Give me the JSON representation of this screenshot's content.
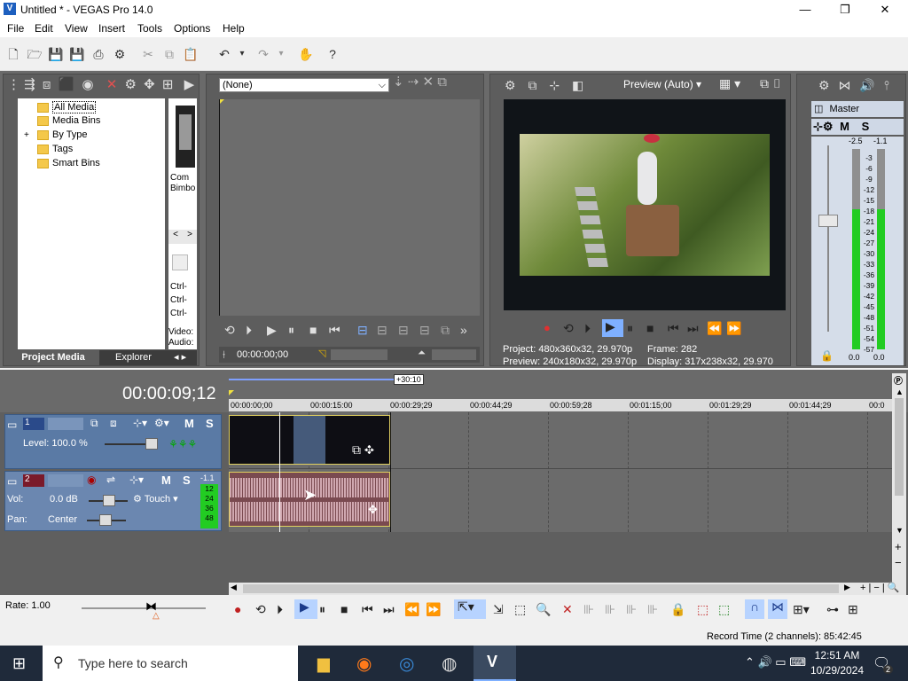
{
  "window": {
    "title": "Untitled * - VEGAS Pro 14.0",
    "minimize": "—",
    "maximize": "❐",
    "close": "✕"
  },
  "menu": [
    "File",
    "Edit",
    "View",
    "Insert",
    "Tools",
    "Options",
    "Help"
  ],
  "project_media": {
    "tree": [
      "All Media",
      "Media Bins",
      "By Type",
      "Tags",
      "Smart Bins"
    ],
    "expand": "+",
    "tabs": [
      "Project Media",
      "Explorer"
    ],
    "thumb_caption": [
      "Com",
      "Bimbo"
    ],
    "nav": [
      "<",
      ">"
    ],
    "ctrl_labels": [
      "Ctrl-",
      "Ctrl-",
      "Ctrl-"
    ],
    "bottom_labels": [
      "Video:",
      "Audio:"
    ]
  },
  "trimmer": {
    "dropdown": "(None)",
    "timecode": "00:00:00;00"
  },
  "preview": {
    "mode": "Preview (Auto)",
    "project_label": "Project:",
    "project_value": "480x360x32, 29.970p",
    "preview_label": "Preview:",
    "preview_value": "240x180x32, 29.970p",
    "frame_label": "Frame:",
    "frame_value": "282",
    "display_label": "Display:",
    "display_value": "317x238x32, 29.970"
  },
  "master": {
    "title": "Master",
    "peak_l": "-2.5",
    "peak_r": "-1.1",
    "scale": [
      "3",
      "6",
      "9",
      "12",
      "15",
      "18",
      "21",
      "24",
      "27",
      "30",
      "33",
      "36",
      "39",
      "42",
      "45",
      "48",
      "51",
      "54",
      "57"
    ],
    "level_l": "0.0",
    "level_r": "0.0",
    "ms": [
      "M",
      "S"
    ],
    "meter_fill": 0.7
  },
  "timeline": {
    "timecode": "00:00:09;12",
    "region_len": "+30:10",
    "ruler": [
      "00:00:00;00",
      "00:00:15:00",
      "00:00:29;29",
      "00:00:44;29",
      "00:00:59;28",
      "00:01:15;00",
      "00:01:29;29",
      "00:01:44;29",
      "00:0"
    ],
    "video_track": {
      "number": "1",
      "level_label": "Level: 100.0 %",
      "m": "M",
      "s": "S"
    },
    "audio_track": {
      "number": "2",
      "vol_label": "Vol:",
      "vol_value": "0.0 dB",
      "pan_label": "Pan:",
      "pan_value": "Center",
      "touch": "Touch",
      "m": "M",
      "s": "S",
      "peak": "-1.1",
      "meter_scale": [
        "12",
        "24",
        "36",
        "48"
      ]
    },
    "rate": "Rate: 1.00",
    "record_time": "Record Time (2 channels): 85:42:45"
  },
  "taskbar": {
    "search_placeholder": "Type here to search",
    "time": "12:51 AM",
    "date": "10/29/2024",
    "notifications": "2"
  }
}
